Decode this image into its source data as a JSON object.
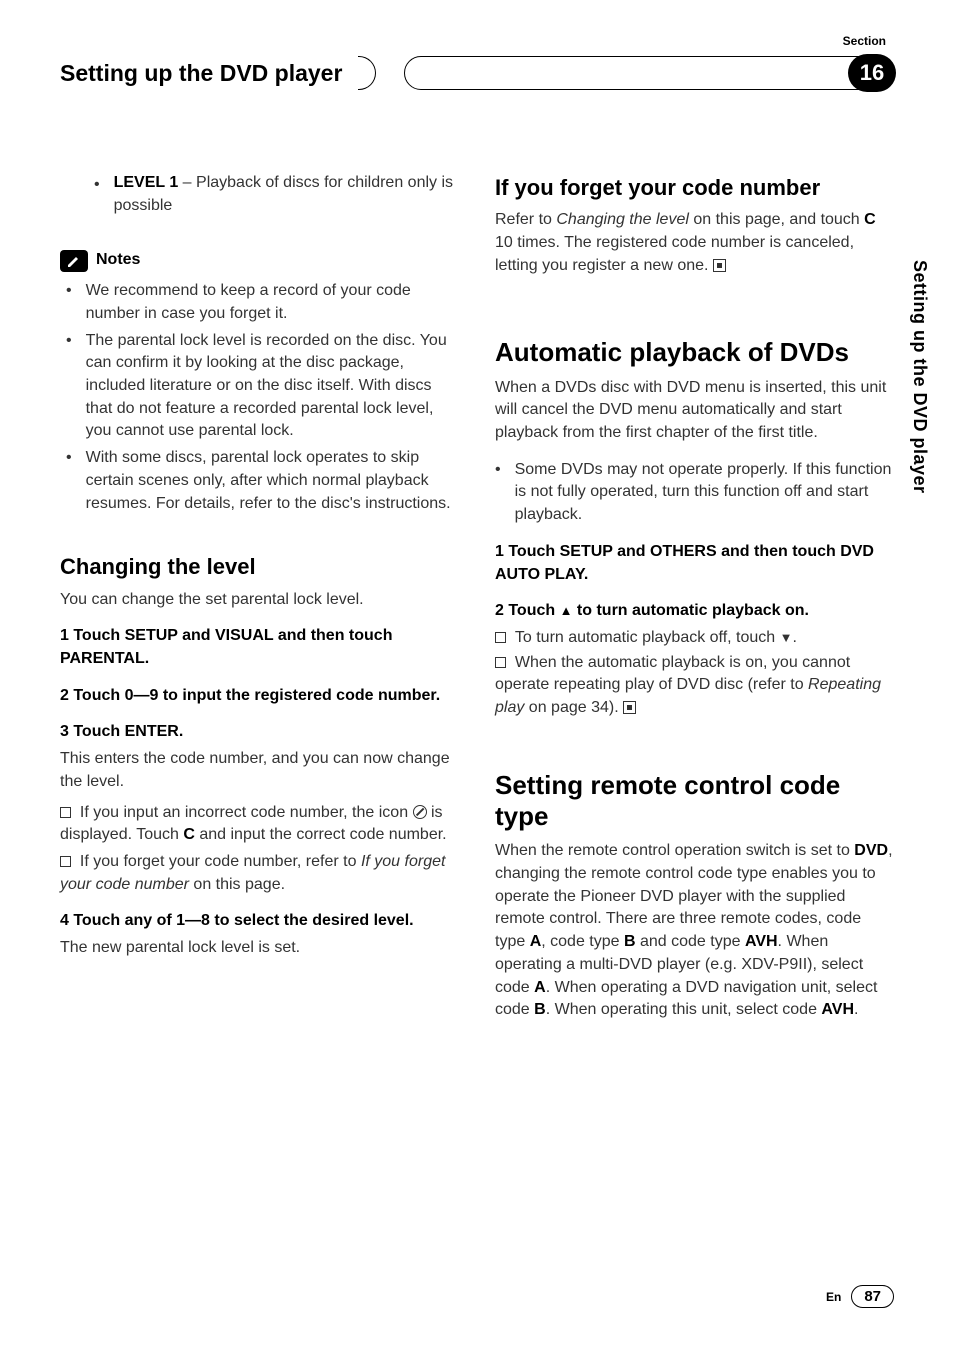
{
  "header": {
    "section_label": "Section",
    "chapter_title": "Setting up the DVD player",
    "chapter_number": "16"
  },
  "side_tab": "Setting up the DVD player",
  "left": {
    "level1_bold": "LEVEL 1",
    "level1_rest": " – Playback of discs for children only is possible",
    "notes_label": "Notes",
    "note1": "We recommend to keep a record of your code number in case you forget it.",
    "note2": "The parental lock level is recorded on the disc. You can confirm it by looking at the disc package, included literature or on the disc itself. With discs that do not feature a recorded parental lock level, you cannot use parental lock.",
    "note3": "With some discs, parental lock operates to skip certain scenes only, after which normal playback resumes. For details, refer to the disc's instructions.",
    "h_changing": "Changing the level",
    "changing_intro": "You can change the set parental lock level.",
    "s1": "1    Touch SETUP and VISUAL and then touch PARENTAL.",
    "s2": "2    Touch 0—9 to input the registered code number.",
    "s3": "3    Touch ENTER.",
    "s3_body": "This enters the code number, and you can now change the level.",
    "s3_tip1a": "If you input an incorrect code number, the icon ",
    "s3_tip1b": " is displayed. Touch ",
    "s3_tip1c": " and input the correct code number.",
    "s3_tip1_C": "C",
    "s3_tip2a": "If you forget your code number, refer to ",
    "s3_tip2b": "If you forget your code number",
    "s3_tip2c": " on this page.",
    "s4": "4    Touch any of 1—8 to select the desired level.",
    "s4_body": "The new parental lock level is set."
  },
  "right": {
    "h_forget": "If you forget your code number",
    "forget_a": "Refer to ",
    "forget_b": "Changing the level",
    "forget_c": " on this page, and touch ",
    "forget_C": "C",
    "forget_d": " 10 times. The registered code number is canceled, letting you register a new one.",
    "h_auto": "Automatic playback of DVDs",
    "auto_intro": "When a DVDs disc with DVD menu is inserted, this unit will cancel the DVD menu automatically and start playback from the first chapter of the first title.",
    "auto_bullet": "Some DVDs may not operate properly. If this function is not fully operated, turn this function off and start playback.",
    "auto_s1": "1    Touch SETUP and OTHERS and then touch DVD AUTO PLAY.",
    "auto_s2a": "2    Touch ",
    "auto_s2b": " to turn automatic playback on.",
    "auto_tip1a": "To turn automatic playback off, touch ",
    "auto_tip1b": ".",
    "auto_tip2a": "When the automatic playback is on, you cannot operate repeating play of DVD disc (refer to ",
    "auto_tip2b": "Repeating play",
    "auto_tip2c": " on page 34).",
    "h_remote": "Setting remote control code type",
    "remote_a": "When the remote control operation switch is set to ",
    "remote_DVD": "DVD",
    "remote_b": ", changing the remote control code type enables you to operate the Pioneer DVD player with the supplied remote control. There are three remote codes, code type ",
    "remote_A": "A",
    "remote_c": ", code type ",
    "remote_B": "B",
    "remote_d": " and code type ",
    "remote_AVH": "AVH",
    "remote_e": ". When operating a multi-DVD player (e.g. XDV-P9II), select code ",
    "remote_f": ". When operating a DVD navigation unit, select code ",
    "remote_g": ". When operating this unit, select code ",
    "remote_h": "."
  },
  "footer": {
    "lang": "En",
    "page": "87"
  }
}
